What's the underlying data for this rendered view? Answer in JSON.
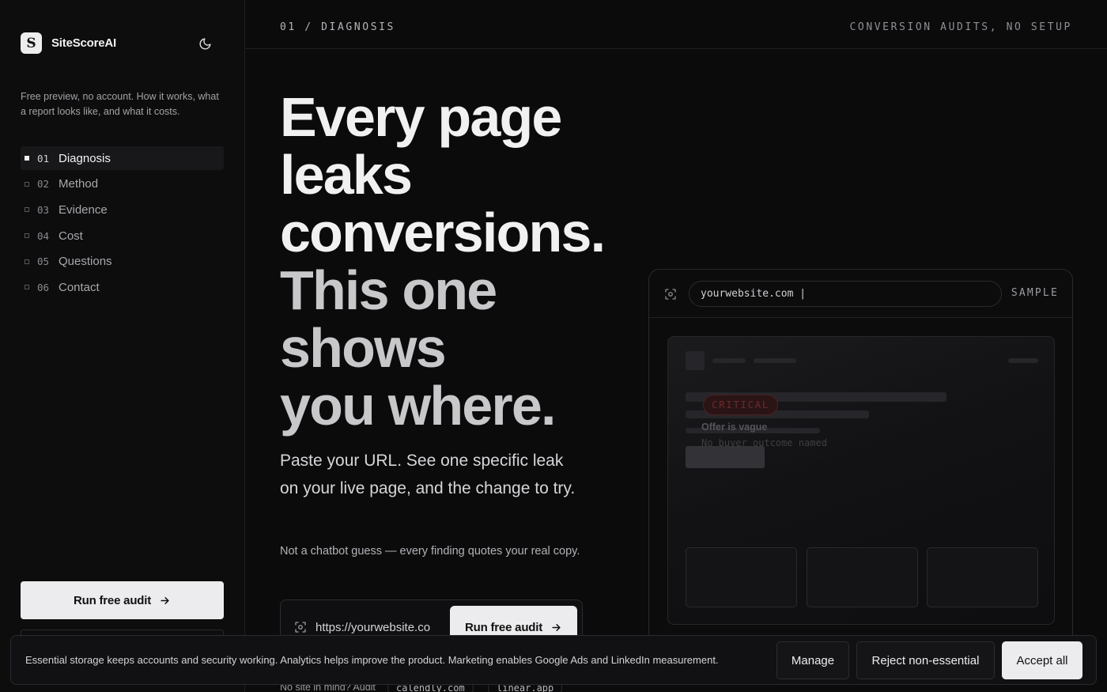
{
  "sidebar": {
    "brand": "SiteScoreAI",
    "tagline": "Free preview, no account. How it works, what a report looks like, and what it costs.",
    "nav": [
      {
        "num": "01",
        "label": "Diagnosis",
        "active": true
      },
      {
        "num": "02",
        "label": "Method",
        "active": false
      },
      {
        "num": "03",
        "label": "Evidence",
        "active": false
      },
      {
        "num": "04",
        "label": "Cost",
        "active": false
      },
      {
        "num": "05",
        "label": "Questions",
        "active": false
      },
      {
        "num": "06",
        "label": "Contact",
        "active": false
      }
    ],
    "cta_label": "Run free audit"
  },
  "topbar": {
    "breadcrumb": "01 / DIAGNOSIS",
    "right_text": "CONVERSION AUDITS, NO SETUP"
  },
  "hero": {
    "headline_lines": [
      "Every page",
      "leaks",
      "conversions."
    ],
    "headline_lines_muted": [
      "This one",
      "shows",
      "you where."
    ],
    "lead": "Paste your URL. See one specific leak on your live page, and the change to try.",
    "sub": "Not a chatbot guess — every finding quotes your real copy.",
    "url_value": "https://yourwebsite.co",
    "cta_label": "Run free audit",
    "no_site_text": "No site in mind? Audit",
    "examples": [
      "calendly.com",
      "linear.app"
    ]
  },
  "sample": {
    "url": "yourwebsite.com |",
    "tag": "SAMPLE",
    "severity": "CRITICAL",
    "finding_title": "Offer is vague",
    "finding_desc": "No buyer outcome named"
  },
  "cookie": {
    "text": "Essential storage keeps accounts and security working. Analytics helps improve the product. Marketing enables Google Ads and LinkedIn measurement.",
    "manage": "Manage",
    "reject": "Reject non-essential",
    "accept": "Accept all"
  }
}
